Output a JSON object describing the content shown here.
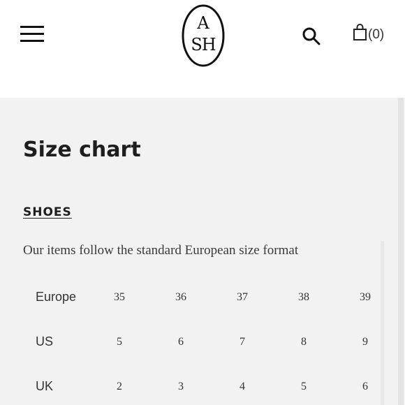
{
  "header": {
    "logo": {
      "top_letter": "A",
      "bottom_letters": "SH"
    },
    "cart_count": "(0)"
  },
  "page": {
    "title": "Size chart",
    "section_heading": "SHOES",
    "intro": "Our items follow the standard European size format"
  },
  "size_table": {
    "rows": [
      {
        "label": "Europe",
        "values": [
          "35",
          "36",
          "37",
          "38",
          "39"
        ]
      },
      {
        "label": "US",
        "values": [
          "5",
          "6",
          "7",
          "8",
          "9"
        ]
      },
      {
        "label": "UK",
        "values": [
          "2",
          "3",
          "4",
          "5",
          "6"
        ]
      }
    ]
  },
  "icons": {
    "menu": "hamburger-menu-icon",
    "search": "search-icon",
    "cart": "shopping-bag-icon"
  }
}
